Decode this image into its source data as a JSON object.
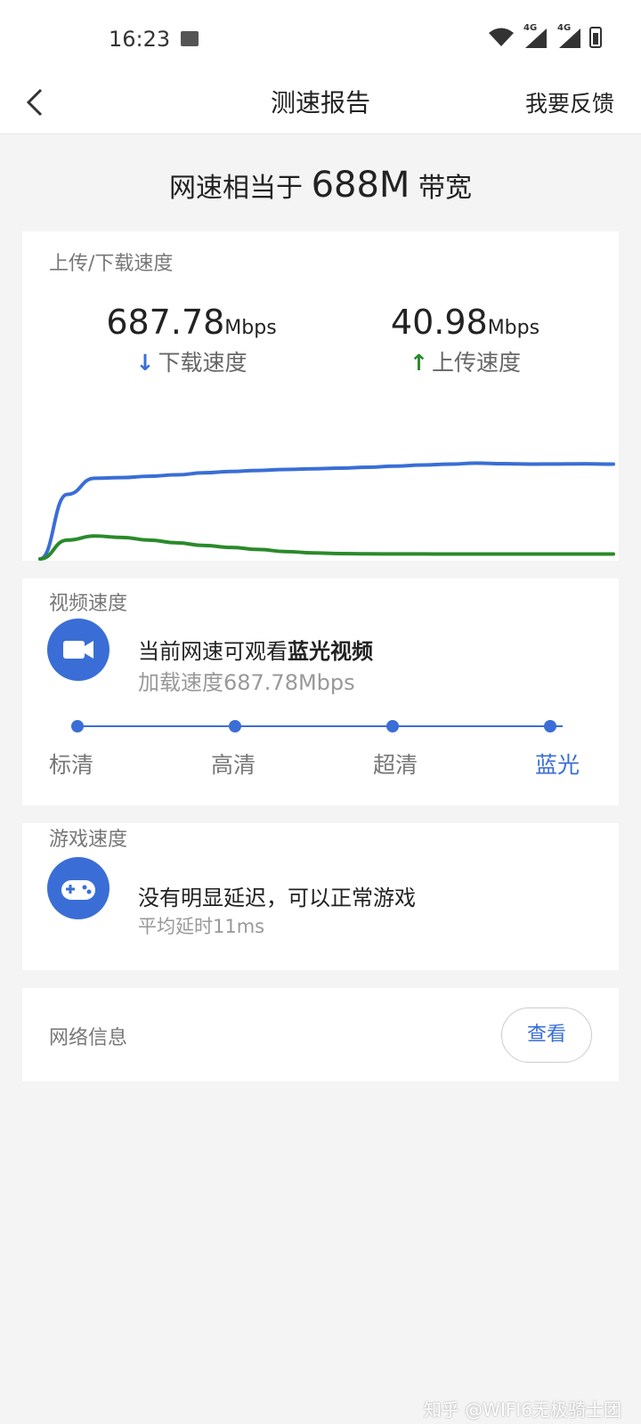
{
  "status_bar": {
    "time": "16:23",
    "icons": [
      "image-icon",
      "wifi-icon",
      "signal-4g-icon",
      "signal-4g-icon",
      "battery-icon"
    ],
    "network_tag": "4G"
  },
  "nav": {
    "title": "测速报告",
    "feedback": "我要反馈",
    "back_icon": "chevron-left-icon"
  },
  "headline": {
    "prefix": "网速相当于",
    "value": "688M",
    "suffix": "带宽"
  },
  "speed": {
    "label": "上传/下载速度",
    "download": {
      "value": "687.78",
      "unit": "Mbps",
      "label": "下载速度",
      "color": "#3a6ed6"
    },
    "upload": {
      "value": "40.98",
      "unit": "Mbps",
      "label": "上传速度",
      "color": "#2a8a2a"
    }
  },
  "chart_data": {
    "type": "line",
    "title": "",
    "xlabel": "",
    "ylabel": "",
    "ylim": [
      0,
      900
    ],
    "grid": false,
    "series": [
      {
        "color": "#3a6ed6",
        "values": [
          0,
          480,
          600,
          605,
          615,
          625,
          640,
          650,
          658,
          665,
          670,
          675,
          682,
          690,
          698,
          705,
          712,
          708,
          705,
          706,
          707,
          705
        ]
      },
      {
        "color": "#2a8a2a",
        "values": [
          0,
          140,
          170,
          160,
          140,
          120,
          100,
          85,
          70,
          55,
          45,
          40,
          38,
          37,
          37,
          36,
          36,
          36,
          36,
          36,
          36,
          36
        ]
      }
    ]
  },
  "video": {
    "label": "视频速度",
    "icon": "video-camera-icon",
    "main_prefix": "当前网速可观看",
    "main_bold": "蓝光视频",
    "sub": "加载速度687.78Mbps",
    "levels": [
      "标清",
      "高清",
      "超清",
      "蓝光"
    ],
    "active_level": "蓝光",
    "accent": "#3a6ed6"
  },
  "game": {
    "label": "游戏速度",
    "icon": "gamepad-icon",
    "main": "没有明显延迟，可以正常游戏",
    "sub": "平均延时11ms"
  },
  "network": {
    "label": "网络信息",
    "button": "查看"
  },
  "watermark": "知乎 @WIFI6无极骑士团"
}
